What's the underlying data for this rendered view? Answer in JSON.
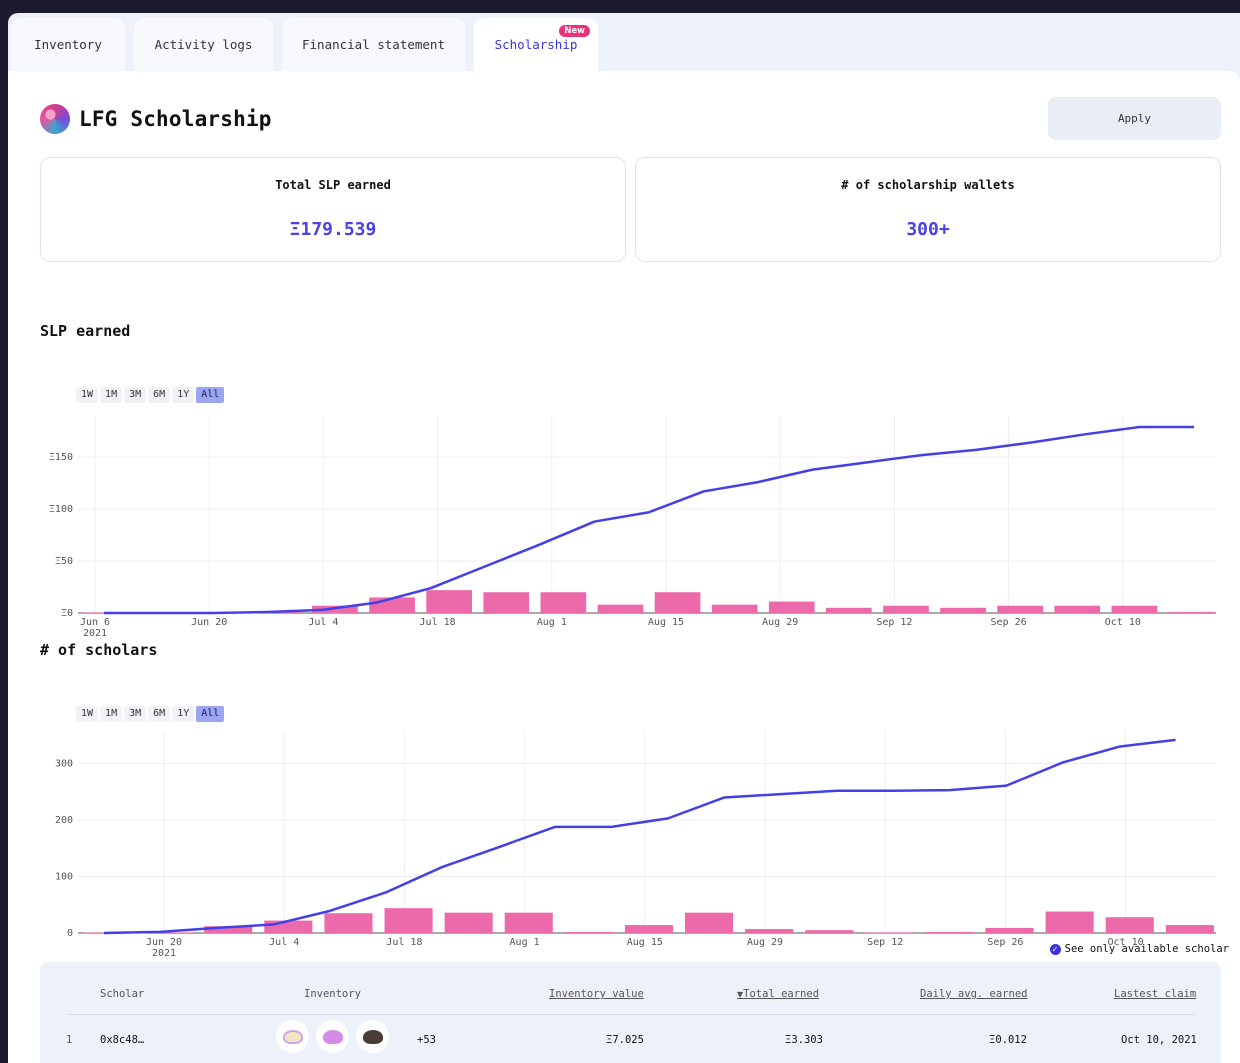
{
  "tabs": [
    {
      "label": "Inventory"
    },
    {
      "label": "Activity logs"
    },
    {
      "label": "Financial statement"
    },
    {
      "label": "Scholarship",
      "badge": "New",
      "active": true
    }
  ],
  "header": {
    "title": "LFG Scholarship",
    "apply_label": "Apply"
  },
  "stats": [
    {
      "label": "Total SLP earned",
      "value": "Ξ179.539"
    },
    {
      "label": "# of scholarship wallets",
      "value": "300+"
    }
  ],
  "range_options": [
    "1W",
    "1M",
    "3M",
    "6M",
    "1Y",
    "All"
  ],
  "range_selected": "All",
  "colors": {
    "accent": "#4a41e6",
    "bar": "#ec6aa9",
    "line": "#4340e8"
  },
  "chart_data": [
    {
      "type": "bar+line",
      "title": "SLP earned",
      "ylim": [
        0,
        180
      ],
      "yticks": [
        0,
        50,
        100,
        150
      ],
      "ytick_labels": [
        "Ξ0",
        "Ξ50",
        "Ξ100",
        "Ξ150"
      ],
      "xticks": [
        "Jun 6",
        "Jun 20",
        "Jul 4",
        "Jul 18",
        "Aug 1",
        "Aug 15",
        "Aug 29",
        "Sep 12",
        "Sep 26",
        "Oct 10"
      ],
      "xtick_sub": [
        "2021",
        "",
        "",
        "",
        "",
        "",
        "",
        "",
        "",
        ""
      ],
      "bars": [
        0,
        0,
        0,
        1,
        7,
        15,
        22,
        20,
        20,
        8,
        20,
        8,
        11,
        5,
        7,
        5,
        7,
        7,
        7,
        1
      ],
      "line": [
        0,
        0,
        0,
        1,
        3,
        10,
        24,
        45,
        66,
        88,
        97,
        117,
        126,
        138,
        145,
        152,
        157,
        164,
        172,
        179,
        179
      ]
    },
    {
      "type": "bar+line",
      "title": "# of scholars",
      "ylim": [
        0,
        340
      ],
      "yticks": [
        0,
        100,
        200,
        300
      ],
      "ytick_labels": [
        "0",
        "100",
        "200",
        "300"
      ],
      "xticks": [
        "Jun 20",
        "Jul 4",
        "Jul 18",
        "Aug 1",
        "Aug 15",
        "Aug 29",
        "Sep 12",
        "Sep 26",
        "Oct 10"
      ],
      "xtick_sub": [
        "2021",
        "",
        "",
        "",
        "",
        "",
        "",
        "",
        ""
      ],
      "bars": [
        0,
        0,
        12,
        22,
        35,
        44,
        36,
        36,
        1,
        14,
        36,
        7,
        5,
        0,
        1,
        9,
        38,
        28,
        14
      ],
      "line": [
        0,
        2,
        9,
        15,
        39,
        72,
        117,
        152,
        188,
        188,
        203,
        240,
        246,
        252,
        252,
        253,
        261,
        302,
        330,
        342
      ]
    }
  ],
  "filter": {
    "label": "See only available scholar"
  },
  "table": {
    "headers": [
      "Scholar",
      "Inventory",
      "Inventory value",
      "Total earned",
      "Daily avg. earned",
      "Lastest claim"
    ],
    "rows": [
      {
        "index": "1",
        "scholar": "0x8c48…",
        "more": "+53",
        "inventory_value": "Ξ7.025",
        "total_earned": "Ξ3.303",
        "daily_avg": "Ξ0.012",
        "last_claim": "Oct 10, 2021"
      }
    ]
  }
}
